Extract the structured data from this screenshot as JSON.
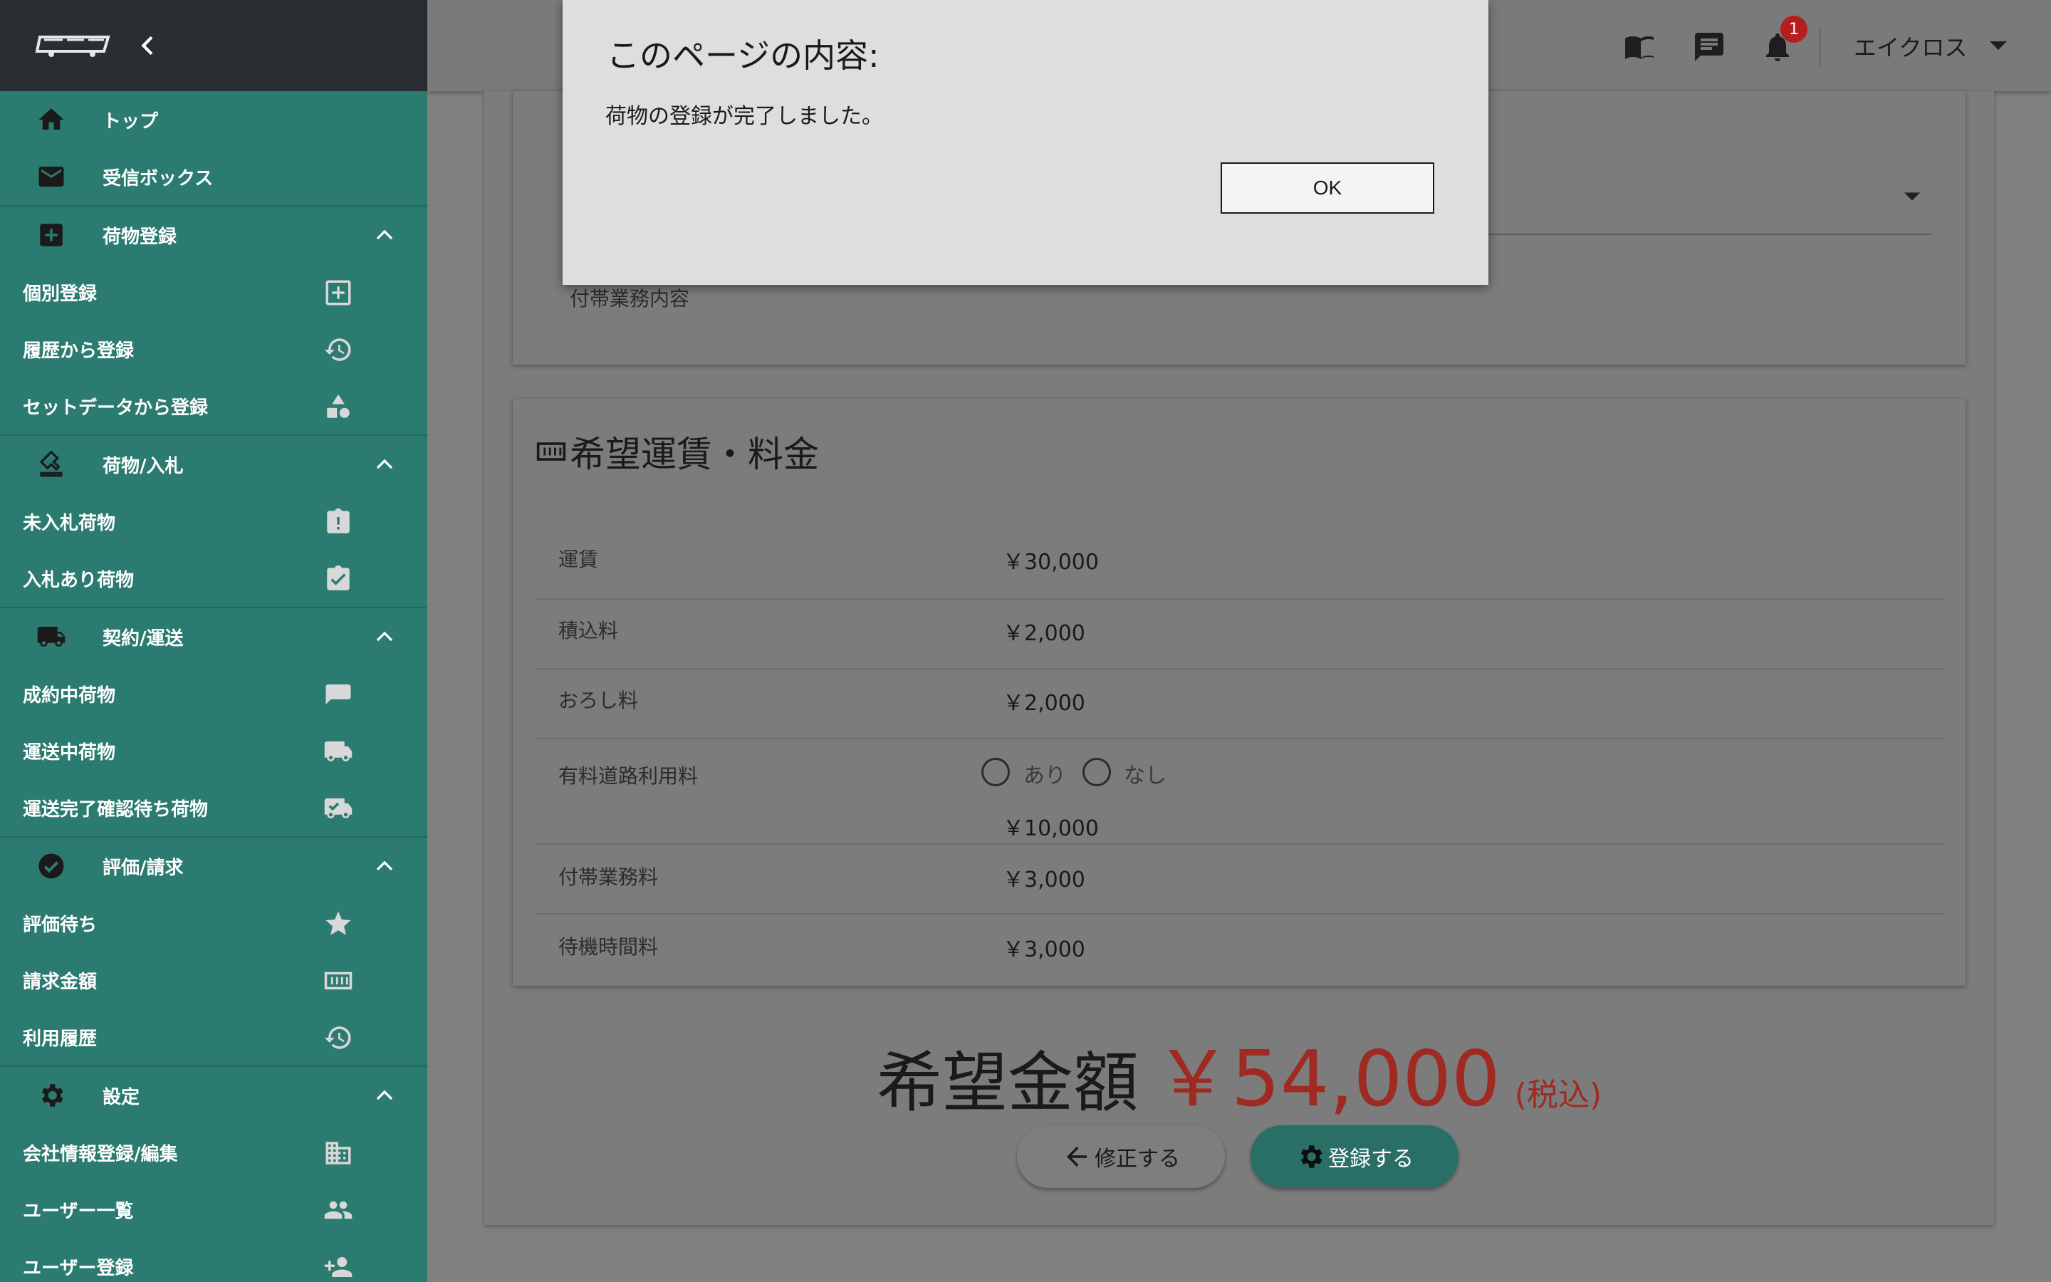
{
  "colors": {
    "sidebar": "#2b7b70",
    "sidebar_header": "#2a2e33",
    "accent_red": "#9e2a22",
    "primary_button": "#2a6f66"
  },
  "sidebar": {
    "items": [
      {
        "type": "main",
        "label": "トップ",
        "icon": "home-icon"
      },
      {
        "type": "main",
        "label": "受信ボックス",
        "icon": "mail-icon"
      },
      {
        "type": "main",
        "label": "荷物登録",
        "icon": "add-box-icon",
        "expanded": true
      },
      {
        "type": "sub",
        "label": "個別登録",
        "icon": "add-square-icon"
      },
      {
        "type": "sub",
        "label": "履歴から登録",
        "icon": "history-icon"
      },
      {
        "type": "sub",
        "label": "セットデータから登録",
        "icon": "shapes-icon"
      },
      {
        "type": "main",
        "label": "荷物/入札",
        "icon": "stamp-icon",
        "expanded": true
      },
      {
        "type": "sub",
        "label": "未入札荷物",
        "icon": "clipboard-alert-icon"
      },
      {
        "type": "sub",
        "label": "入札あり荷物",
        "icon": "clipboard-check-icon"
      },
      {
        "type": "main",
        "label": "契約/運送",
        "icon": "truck-icon",
        "expanded": true
      },
      {
        "type": "sub",
        "label": "成約中荷物",
        "icon": "chat-icon"
      },
      {
        "type": "sub",
        "label": "運送中荷物",
        "icon": "truck-fast-icon"
      },
      {
        "type": "sub",
        "label": "運送完了確認待ち荷物",
        "icon": "truck-check-icon"
      },
      {
        "type": "main",
        "label": "評価/請求",
        "icon": "check-circle-icon",
        "expanded": true
      },
      {
        "type": "sub",
        "label": "評価待ち",
        "icon": "star-icon"
      },
      {
        "type": "sub",
        "label": "請求金額",
        "icon": "money-icon"
      },
      {
        "type": "sub",
        "label": "利用履歴",
        "icon": "history-icon"
      },
      {
        "type": "main",
        "label": "設定",
        "icon": "gear-icon",
        "expanded": true
      },
      {
        "type": "sub",
        "label": "会社情報登録/編集",
        "icon": "building-icon"
      },
      {
        "type": "sub",
        "label": "ユーザー一覧",
        "icon": "people-icon"
      },
      {
        "type": "sub",
        "label": "ユーザー登録",
        "icon": "person-add-icon"
      }
    ]
  },
  "header": {
    "notification_count": "1",
    "user_name": "エイクロス"
  },
  "form": {
    "futai_label": "付帯業務内容"
  },
  "fees": {
    "title": "希望運賃・料金",
    "rows": [
      {
        "label": "運賃",
        "value": "￥30,000"
      },
      {
        "label": "積込料",
        "value": "￥2,000"
      },
      {
        "label": "おろし料",
        "value": "￥2,000"
      },
      {
        "label": "有料道路利用料",
        "value": "￥10,000",
        "radio": [
          "あり",
          "なし"
        ]
      },
      {
        "label": "付帯業務料",
        "value": "￥3,000"
      },
      {
        "label": "待機時間料",
        "value": "￥3,000"
      }
    ]
  },
  "total": {
    "label": "希望金額",
    "value": "￥54,000",
    "tax": "(税込)"
  },
  "buttons": {
    "back": "修正する",
    "register": "登録する"
  },
  "dialog": {
    "title": "このページの内容:",
    "message": "荷物の登録が完了しました。",
    "ok": "OK"
  }
}
